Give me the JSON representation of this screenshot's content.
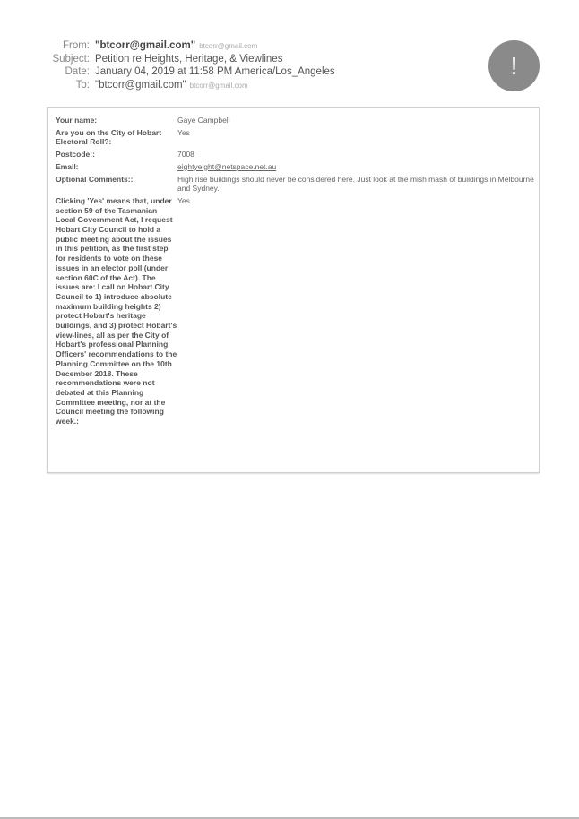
{
  "header": {
    "from_label": "From:",
    "from_name": "\"btcorr@gmail.com\"",
    "from_email": "btcorr@gmail.com",
    "subject_label": "Subject:",
    "subject": "Petition re Heights, Heritage, & Viewlines",
    "date_label": "Date:",
    "date": "January 04, 2019 at 11:58 PM America/Los_Angeles",
    "to_label": "To:",
    "to_name": "\"btcorr@gmail.com\"",
    "to_email": "btcorr@gmail.com"
  },
  "alert_icon": {
    "glyph": "!",
    "semantic": "exclamation-icon"
  },
  "form": {
    "rows": [
      {
        "label": "Your name:",
        "value": "Gaye Campbell"
      },
      {
        "label": "Are you on the City of Hobart Electoral Roll?:",
        "value": "Yes"
      },
      {
        "label": "Postcode::",
        "value": "7008"
      },
      {
        "label": "Email:",
        "value": "eightyeight@netspace.net.au"
      },
      {
        "label": "Optional Comments::",
        "value": "High rise buildings should never be considered here. Just look at the mish mash of buildings in Melbourne and Sydney."
      },
      {
        "label": "Clicking 'Yes' means that, under section 59 of the Tasmanian Local Government Act, I request Hobart City Council to hold a public meeting about the issues in this petition, as the first step for residents to vote on these issues in an elector poll (under section 60C of the Act). The issues are: I call on Hobart City Council to 1) introduce absolute maximum building heights 2) protect Hobart's heritage buildings, and 3) protect Hobart's view-lines, all as per the City of Hobart's professional Planning Officers' recommendations to the Planning Committee on the 10th December 2018. These recommendations were not debated at this Planning Committee meeting, nor at the Council meeting the following week.:",
        "value": "Yes"
      }
    ]
  }
}
